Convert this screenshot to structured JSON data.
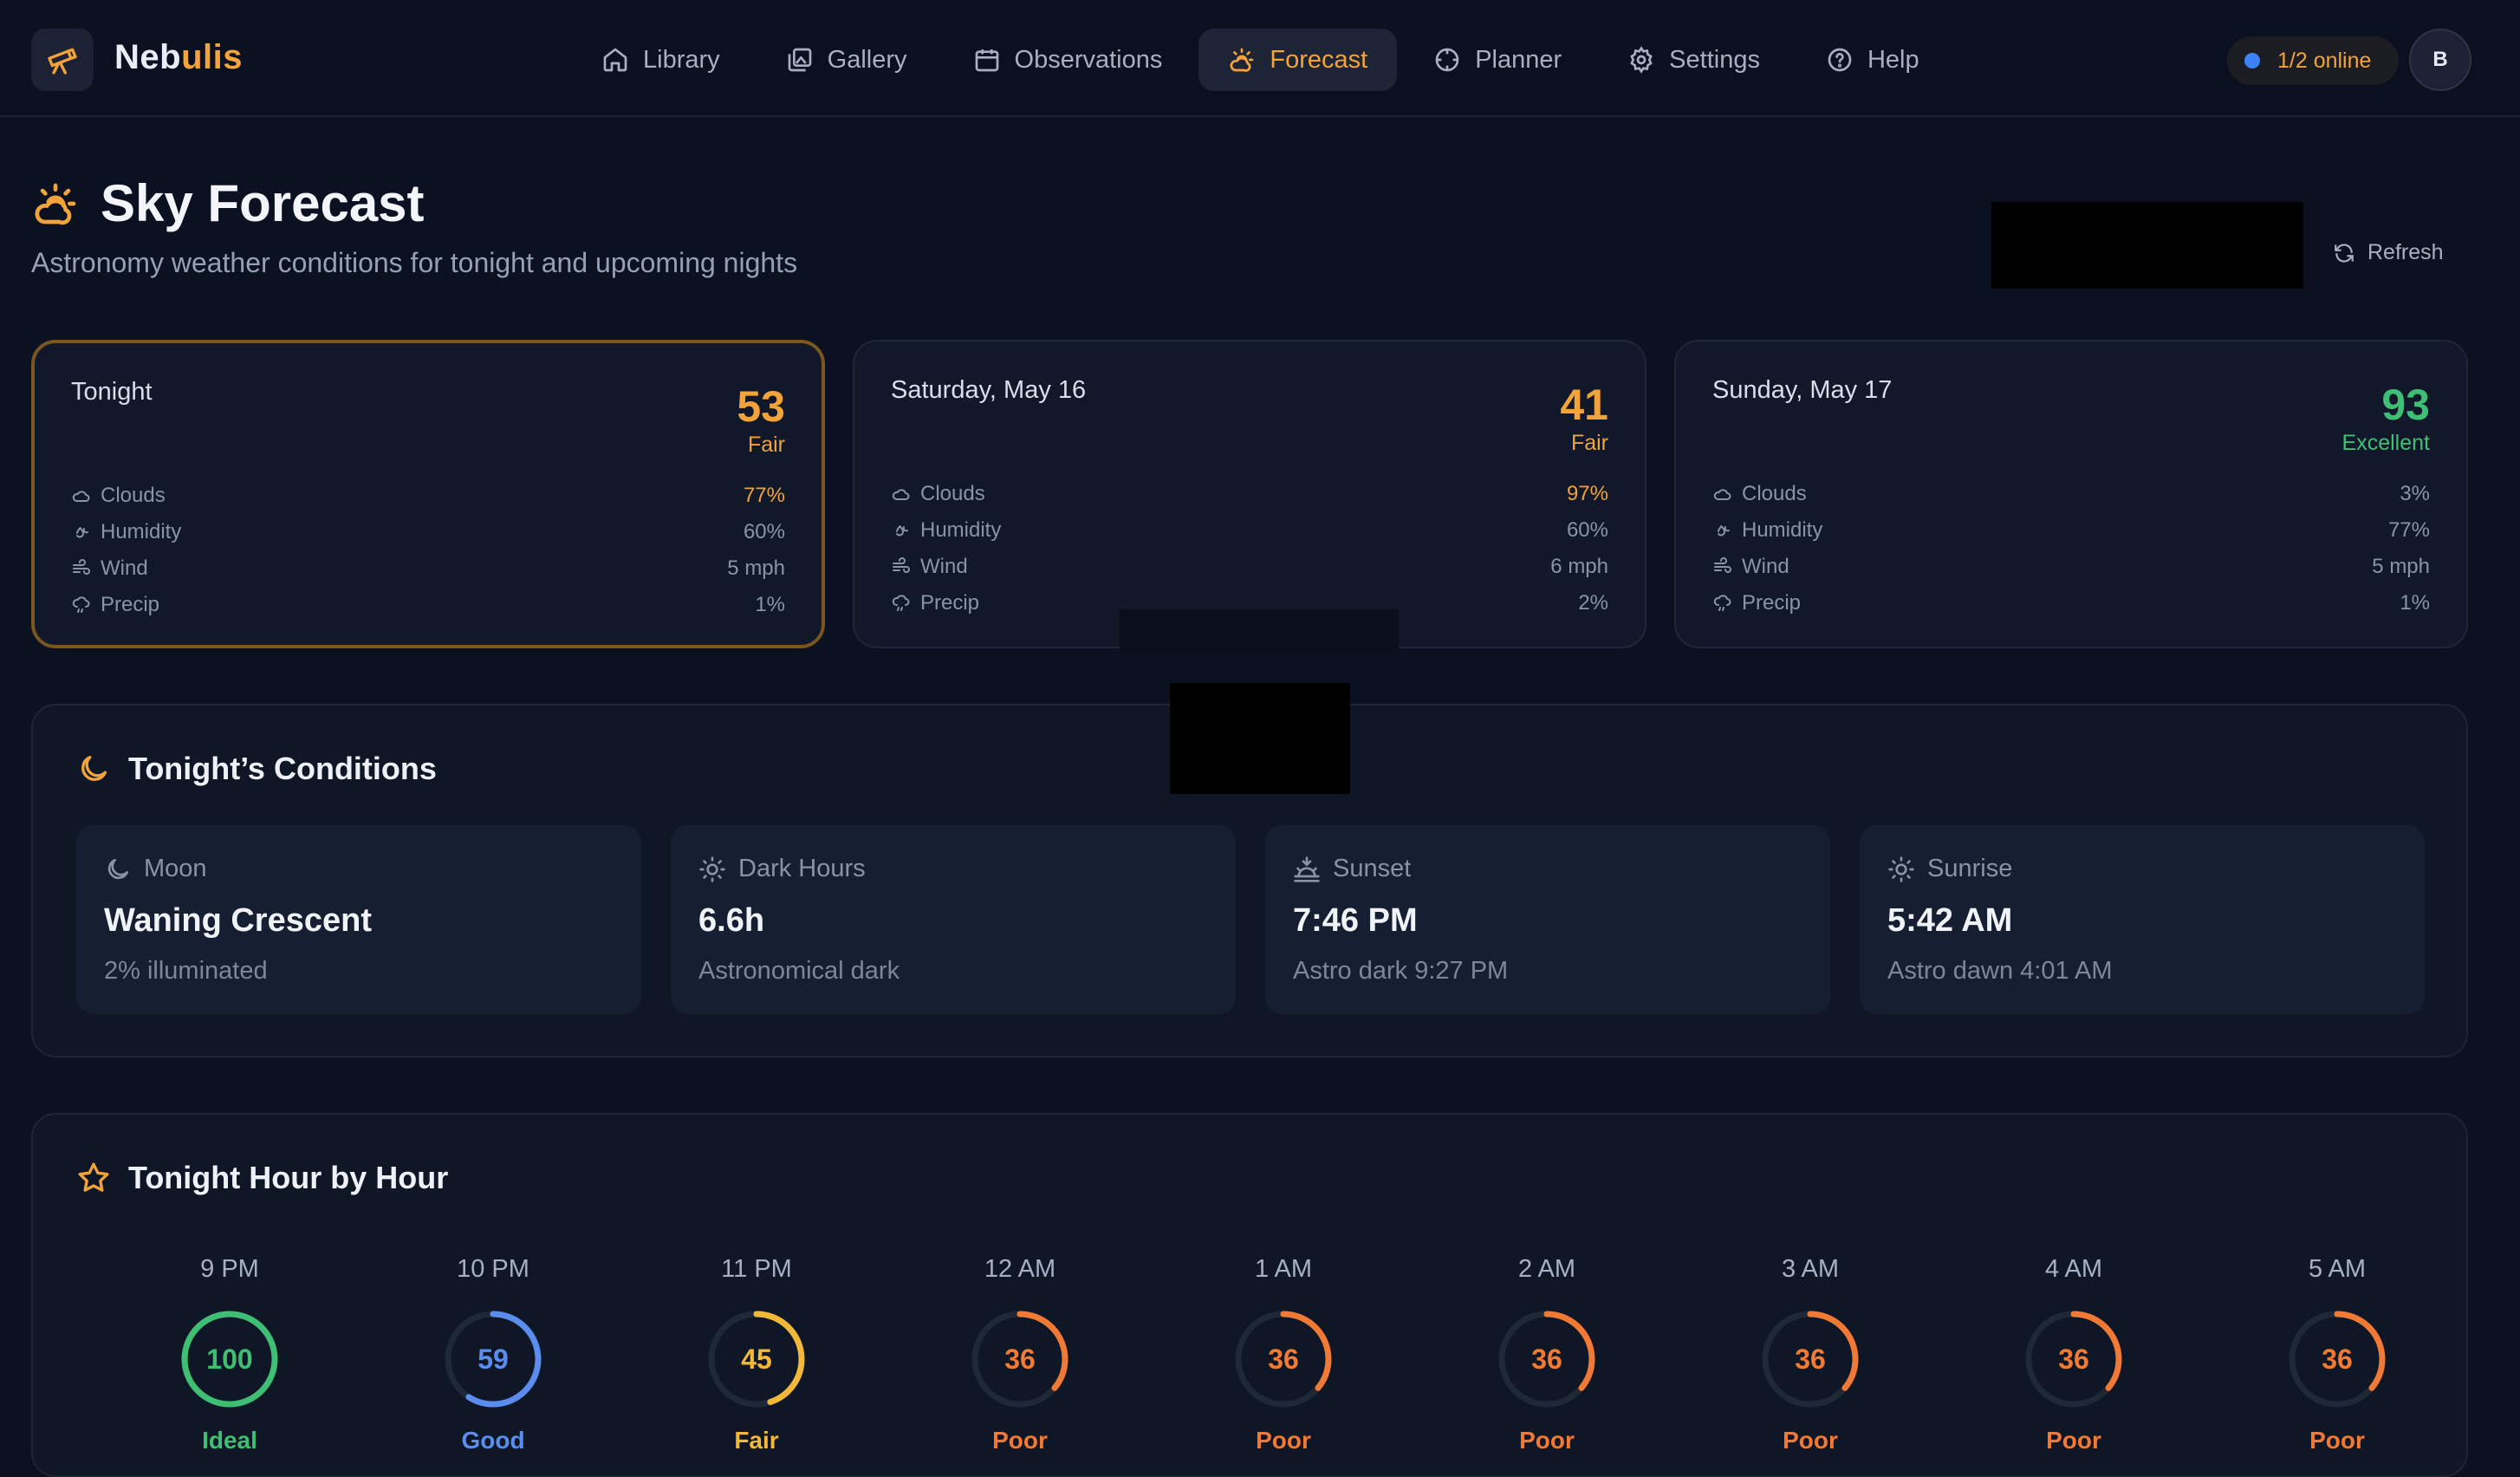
{
  "app": {
    "name_main": "Neb",
    "name_accent": "ulis"
  },
  "nav": [
    {
      "label": "Library",
      "icon": "home-icon"
    },
    {
      "label": "Gallery",
      "icon": "gallery-icon"
    },
    {
      "label": "Observations",
      "icon": "calendar-icon"
    },
    {
      "label": "Forecast",
      "icon": "cloud-sun-icon",
      "active": true
    },
    {
      "label": "Planner",
      "icon": "crosshair-icon"
    },
    {
      "label": "Settings",
      "icon": "gear-icon"
    },
    {
      "label": "Help",
      "icon": "help-icon"
    }
  ],
  "status": {
    "online": "1/2 online",
    "avatar_initial": "B"
  },
  "page": {
    "title": "Sky Forecast",
    "subtitle": "Astronomy weather conditions for tonight and upcoming nights",
    "refresh_label": "Refresh"
  },
  "forecast_cards": [
    {
      "title": "Tonight",
      "score": "53",
      "rating": "Fair",
      "color": "#f2a33a",
      "metrics": [
        {
          "label": "Clouds",
          "value": "77%",
          "highlight": true
        },
        {
          "label": "Humidity",
          "value": "60%"
        },
        {
          "label": "Wind",
          "value": "5 mph"
        },
        {
          "label": "Precip",
          "value": "1%"
        }
      ]
    },
    {
      "title": "Saturday, May 16",
      "score": "41",
      "rating": "Fair",
      "color": "#f2a33a",
      "metrics": [
        {
          "label": "Clouds",
          "value": "97%",
          "highlight": true
        },
        {
          "label": "Humidity",
          "value": "60%"
        },
        {
          "label": "Wind",
          "value": "6 mph"
        },
        {
          "label": "Precip",
          "value": "2%"
        }
      ]
    },
    {
      "title": "Sunday, May 17",
      "score": "93",
      "rating": "Excellent",
      "color": "#3fbf73",
      "metrics": [
        {
          "label": "Clouds",
          "value": "3%"
        },
        {
          "label": "Humidity",
          "value": "77%"
        },
        {
          "label": "Wind",
          "value": "5 mph"
        },
        {
          "label": "Precip",
          "value": "1%"
        }
      ]
    }
  ],
  "conditions": {
    "title": "Tonight’s Conditions",
    "tiles": [
      {
        "label": "Moon",
        "value": "Waning Crescent",
        "sub": "2% illuminated",
        "icon": "moon-icon"
      },
      {
        "label": "Dark Hours",
        "value": "6.6h",
        "sub": "Astronomical dark",
        "icon": "sun-icon"
      },
      {
        "label": "Sunset",
        "value": "7:46 PM",
        "sub": "Astro dark 9:27 PM",
        "icon": "sunset-icon"
      },
      {
        "label": "Sunrise",
        "value": "5:42 AM",
        "sub": "Astro dawn 4:01 AM",
        "icon": "sunrise-icon"
      }
    ]
  },
  "hourly": {
    "title": "Tonight Hour by Hour",
    "hours": [
      {
        "time": "9 PM",
        "score": "100",
        "fraction": 1.0,
        "rating": "Ideal",
        "color": "#3fbf73"
      },
      {
        "time": "10 PM",
        "score": "59",
        "fraction": 0.59,
        "rating": "Good",
        "color": "#5b8def"
      },
      {
        "time": "11 PM",
        "score": "45",
        "fraction": 0.45,
        "rating": "Fair",
        "color": "#f2b83a"
      },
      {
        "time": "12 AM",
        "score": "36",
        "fraction": 0.36,
        "rating": "Poor",
        "color": "#f07a34"
      },
      {
        "time": "1 AM",
        "score": "36",
        "fraction": 0.36,
        "rating": "Poor",
        "color": "#f07a34"
      },
      {
        "time": "2 AM",
        "score": "36",
        "fraction": 0.36,
        "rating": "Poor",
        "color": "#f07a34"
      },
      {
        "time": "3 AM",
        "score": "36",
        "fraction": 0.36,
        "rating": "Poor",
        "color": "#f07a34"
      },
      {
        "time": "4 AM",
        "score": "36",
        "fraction": 0.36,
        "rating": "Poor",
        "color": "#f07a34"
      },
      {
        "time": "5 AM",
        "score": "36",
        "fraction": 0.36,
        "rating": "Poor",
        "color": "#f07a34"
      }
    ]
  }
}
